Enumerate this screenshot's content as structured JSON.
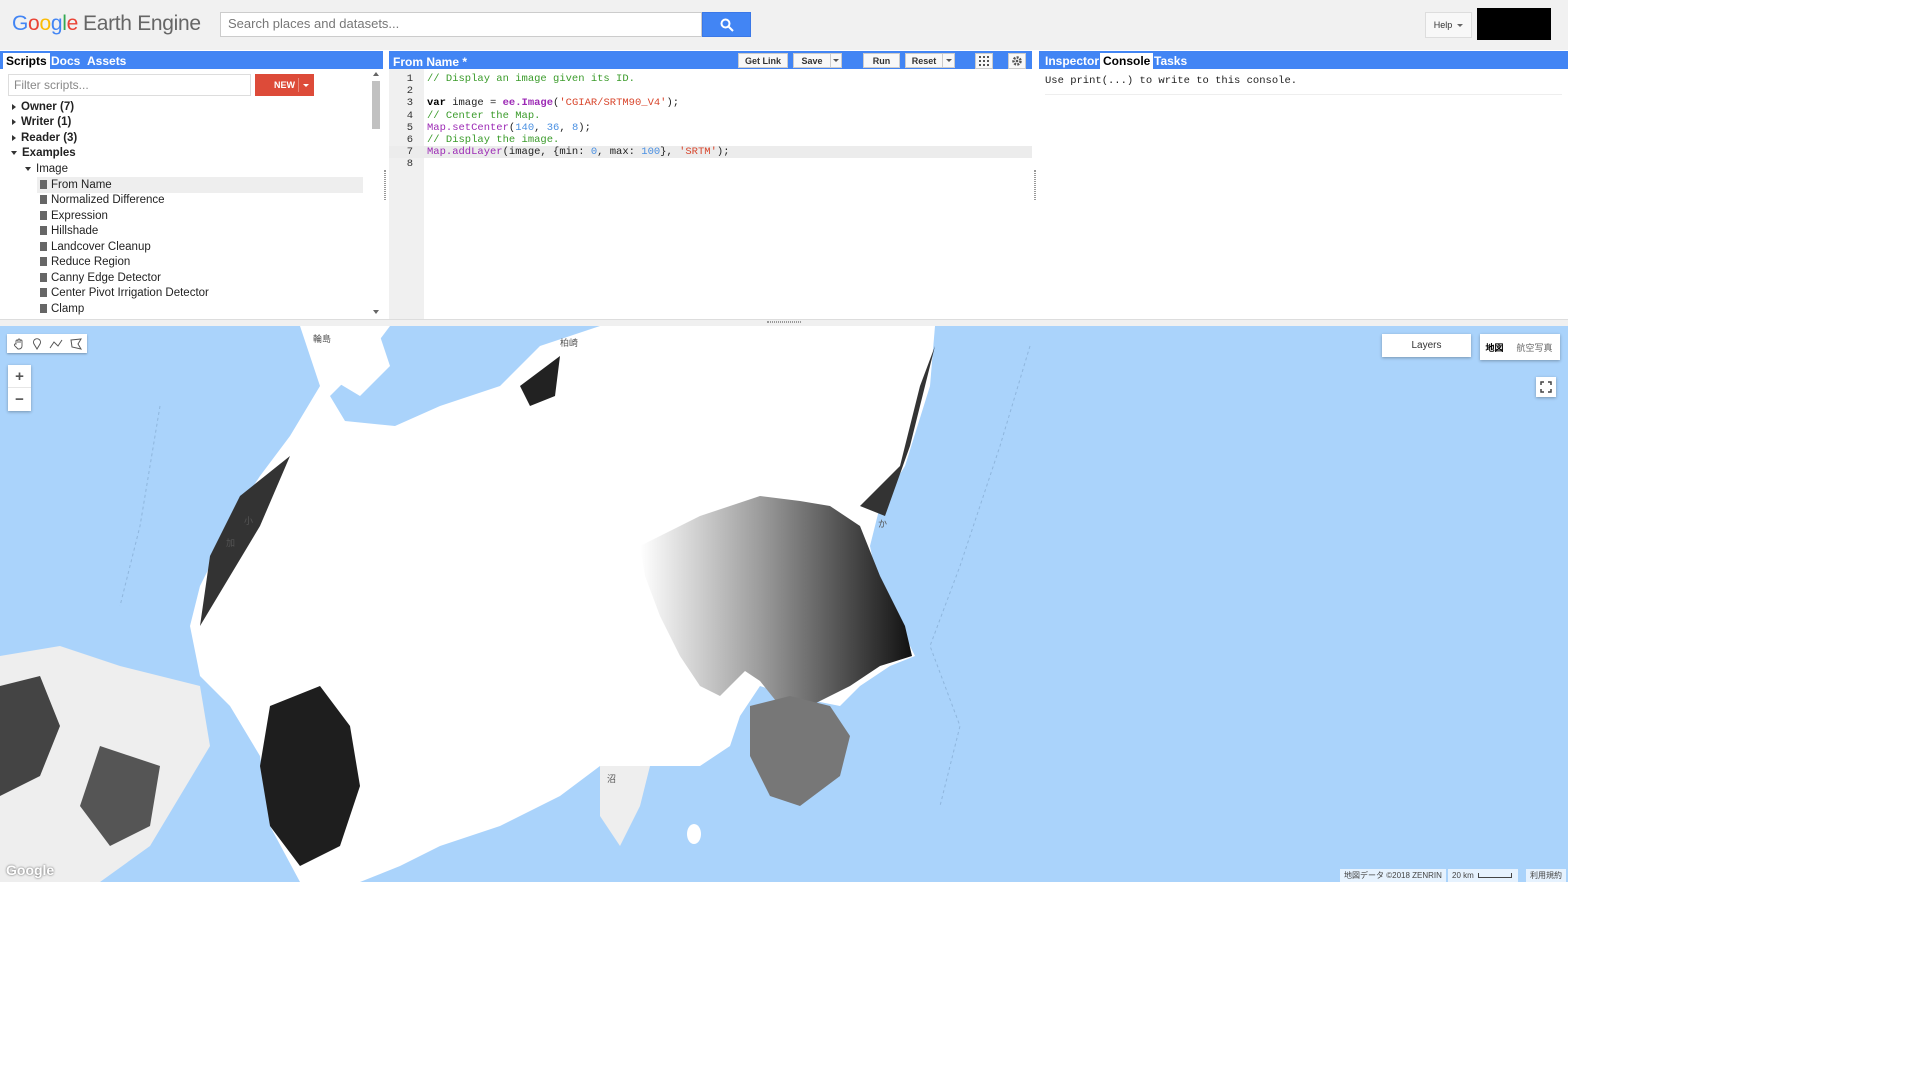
{
  "header": {
    "logo_google": [
      "G",
      "o",
      "o",
      "g",
      "l",
      "e"
    ],
    "logo_product": "Earth Engine",
    "search_placeholder": "Search places and datasets...",
    "help_label": "Help"
  },
  "left_panel": {
    "tabs": [
      "Scripts",
      "Docs",
      "Assets"
    ],
    "active_tab": "Scripts",
    "filter_placeholder": "Filter scripts...",
    "new_label": "NEW",
    "groups": [
      {
        "label": "Owner",
        "count": "(7)"
      },
      {
        "label": "Writer",
        "count": "(1)"
      },
      {
        "label": "Reader",
        "count": "(3)"
      }
    ],
    "examples_label": "Examples",
    "image_folder": "Image",
    "scripts": [
      "From Name",
      "Normalized Difference",
      "Expression",
      "Hillshade",
      "Landcover Cleanup",
      "Reduce Region",
      "Canny Edge Detector",
      "Center Pivot Irrigation Detector",
      "Clamp"
    ],
    "selected_script": "From Name"
  },
  "editor": {
    "title": "From Name *",
    "buttons": {
      "get_link": "Get Link",
      "save": "Save",
      "run": "Run",
      "reset": "Reset"
    },
    "line_numbers": [
      "1",
      "2",
      "3",
      "4",
      "5",
      "6",
      "7",
      "8"
    ],
    "active_line": 7,
    "code": {
      "l1": "// Display an image given its ID.",
      "l3_kw": "var",
      "l3_a": " image = ",
      "l3_fn": "ee.Image",
      "l3_b": "(",
      "l3_str": "'CGIAR/SRTM90_V4'",
      "l3_c": ");",
      "l4": "// Center the Map.",
      "l5_fn": "Map.setCenter",
      "l5_a": "(",
      "l5_n1": "140",
      "l5_b": ", ",
      "l5_n2": "36",
      "l5_c": ", ",
      "l5_n3": "8",
      "l5_d": ");",
      "l6": "// Display the image.",
      "l7_fn": "Map.addLayer",
      "l7_a": "(image, {min: ",
      "l7_n1": "0",
      "l7_b": ", max: ",
      "l7_n2": "100",
      "l7_c": "}, ",
      "l7_str": "'SRTM'",
      "l7_d": ");"
    }
  },
  "right_panel": {
    "tabs": [
      "Inspector",
      "Console",
      "Tasks"
    ],
    "active_tab": "Console",
    "console_text": "Use print(...) to write to this console."
  },
  "map": {
    "layers_label": "Layers",
    "map_type_map": "地図",
    "map_type_satellite": "航空写真",
    "zoom_in": "+",
    "zoom_out": "−",
    "attribution": "地図データ ©2018 ZENRIN",
    "scale": "20 km",
    "terms": "利用規約",
    "google_logo": "Google",
    "place_labels": [
      "輪島",
      "柏崎",
      "小",
      "加",
      "か",
      "沼"
    ],
    "water_color": "#aad3fb"
  }
}
